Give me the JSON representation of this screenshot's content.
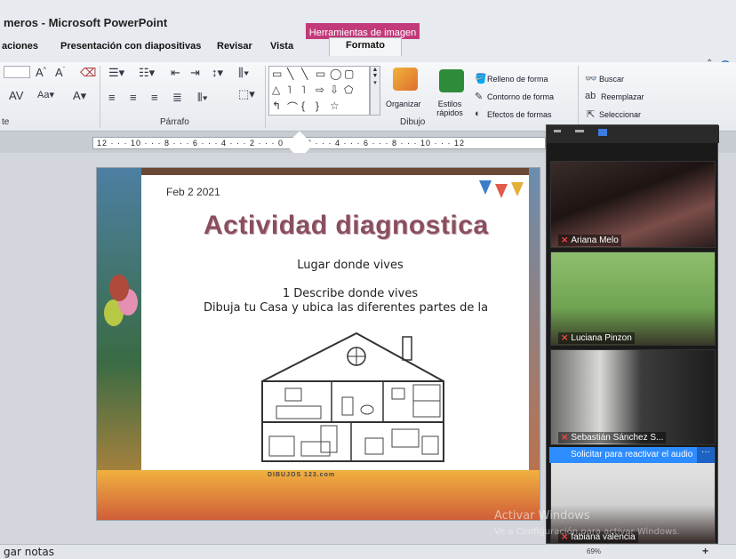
{
  "window": {
    "title": "meros - Microsoft PowerPoint",
    "context_tab": "Herramientas de imagen",
    "controls": {
      "minimize": "—",
      "maximize": "□",
      "close": "✕"
    }
  },
  "ribbon": {
    "tabs": [
      {
        "label": "aciones"
      },
      {
        "label": "Presentación con diapositivas"
      },
      {
        "label": "Revisar"
      },
      {
        "label": "Vista"
      },
      {
        "label": "Formato",
        "active": true
      }
    ],
    "groups": {
      "font": "te",
      "paragraph": "Párrafo",
      "drawing": "Dibujo"
    },
    "drawing": {
      "organize": "Organizar",
      "quick_styles": "Estilos rápidos",
      "shape_fill": "Relleno de forma",
      "shape_outline": "Contorno de forma",
      "shape_effects": "Efectos de formas"
    },
    "editing": {
      "find": "Buscar",
      "replace": "Reemplazar",
      "select": "Seleccionar"
    }
  },
  "ruler": {
    "text": "12 · · · 10 · · · 8 · · · 6 · · · 4 · · · 2 · · · 0 · · · 2 · · · 4 · · · 6 · · · 8 · · · 10 · · · 12"
  },
  "slide": {
    "date": "Feb 2 2021",
    "title": "Actividad diagnostica",
    "line1": "Lugar donde vives",
    "line2": "1 Describe donde vives",
    "line3": "Dibuja tu Casa y ubica las diferentes partes de la",
    "logo_text": "DIBUJOS 123.com"
  },
  "windows_watermark": {
    "line1": "Activar Windows",
    "line2": "Ve a Configuración para activar Windows."
  },
  "statusbar": {
    "notes": "gar notas",
    "zoom": "69%"
  },
  "zoom": {
    "participants": [
      {
        "name": "Ariana Melo",
        "muted": true
      },
      {
        "name": "Luciana Pinzon",
        "muted": true
      },
      {
        "name": "Sebastián Sánchez S...",
        "muted": true
      },
      {
        "name": "fabiana valencia",
        "muted": true
      }
    ],
    "audio_request": "Solicitar para reactivar el audio",
    "more": "···"
  }
}
